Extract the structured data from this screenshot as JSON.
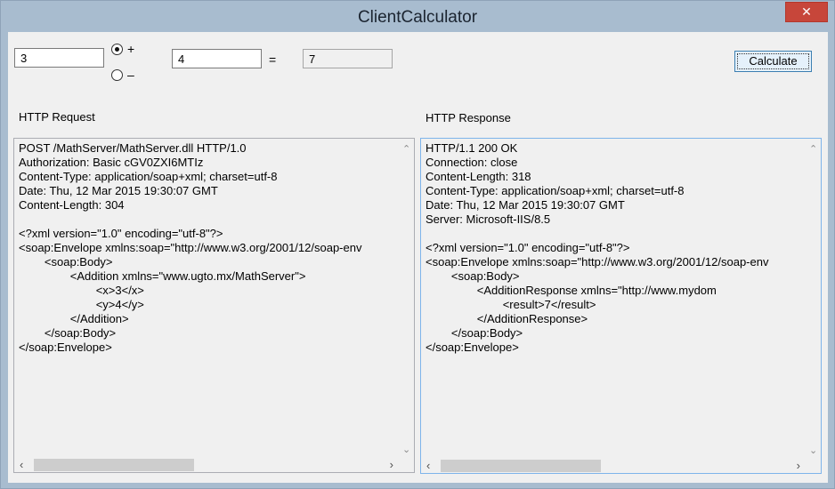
{
  "window": {
    "title": "ClientCalculator",
    "close_label": "✕"
  },
  "calculator": {
    "operand1": "3",
    "operand2": "4",
    "result": "7",
    "equals_label": "=",
    "op_plus_label": "+",
    "op_minus_label": "–",
    "selected_operation": "+",
    "calculate_label": "Calculate"
  },
  "request": {
    "label": "HTTP Request",
    "text": "POST /MathServer/MathServer.dll HTTP/1.0\nAuthorization: Basic cGV0ZXI6MTIz\nContent-Type: application/soap+xml; charset=utf-8\nDate: Thu, 12 Mar 2015 19:30:07 GMT\nContent-Length: 304\n\n<?xml version=\"1.0\" encoding=\"utf-8\"?>\n<soap:Envelope xmlns:soap=\"http://www.w3.org/2001/12/soap-env\n\t\t<soap:Body>\n\t\t\t\t<Addition xmlns=\"www.ugto.mx/MathServer\">\n\t\t\t\t\t\t<x>3</x>\n\t\t\t\t\t\t<y>4</y>\n\t\t\t\t</Addition>\n\t\t</soap:Body>\n</soap:Envelope>"
  },
  "response": {
    "label": "HTTP Response",
    "text": "HTTP/1.1 200 OK\nConnection: close\nContent-Length: 318\nContent-Type: application/soap+xml; charset=utf-8\nDate: Thu, 12 Mar 2015 19:30:07 GMT\nServer: Microsoft-IIS/8.5\n\n<?xml version=\"1.0\" encoding=\"utf-8\"?>\n<soap:Envelope xmlns:soap=\"http://www.w3.org/2001/12/soap-env\n\t\t<soap:Body>\n\t\t\t\t<AdditionResponse xmlns=\"http://www.mydom\n\t\t\t\t\t\t<result>7</result>\n\t\t\t\t</AdditionResponse>\n\t\t</soap:Body>\n</soap:Envelope>"
  },
  "icons": {
    "scroll_up": "up-arrow-icon",
    "scroll_down": "down-arrow-icon",
    "scroll_left": "left-arrow-icon",
    "scroll_right": "right-arrow-icon"
  },
  "colors": {
    "close_button": "#c7463a",
    "title_bar": "#a8bccf"
  }
}
